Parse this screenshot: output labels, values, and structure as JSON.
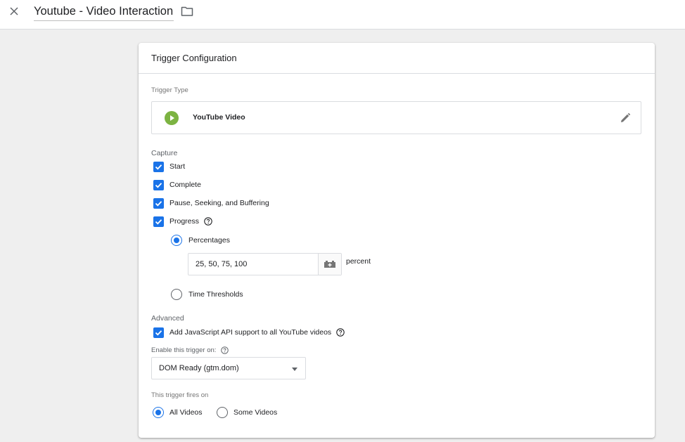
{
  "header": {
    "title": "Youtube - Video Interaction",
    "close_icon": "close-icon",
    "folder_icon": "folder-icon"
  },
  "card": {
    "title": "Trigger Configuration",
    "trigger_type": {
      "label": "Trigger Type",
      "name": "YouTube Video",
      "icon": "play-icon",
      "icon_color": "#7cb342"
    },
    "capture": {
      "label": "Capture",
      "options": [
        {
          "label": "Start",
          "checked": true
        },
        {
          "label": "Complete",
          "checked": true
        },
        {
          "label": "Pause, Seeking, and Buffering",
          "checked": true
        },
        {
          "label": "Progress",
          "checked": true
        }
      ],
      "progress": {
        "percentages_label": "Percentages",
        "percentages_selected": true,
        "percent_value": "25, 50, 75, 100",
        "percent_suffix": "percent",
        "time_label": "Time Thresholds",
        "time_selected": false
      }
    },
    "advanced": {
      "label": "Advanced",
      "js_api_label": "Add JavaScript API support to all YouTube videos",
      "js_api_checked": true,
      "enable_label": "Enable this trigger on:",
      "enable_value": "DOM Ready (gtm.dom)"
    },
    "fires": {
      "label": "This trigger fires on",
      "all_label": "All Videos",
      "all_selected": true,
      "some_label": "Some Videos",
      "some_selected": false
    }
  },
  "colors": {
    "accent": "#1a73e8",
    "background": "#efefef"
  }
}
